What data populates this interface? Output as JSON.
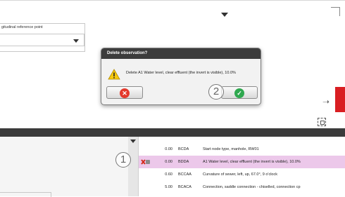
{
  "dialog": {
    "title": "Delete observation?",
    "message": "Delete A1 Water level, clear effluent (the invert is visible), 10.0%",
    "buttons": [
      {
        "name": "cancel",
        "icon": "red-x-icon"
      },
      {
        "name": "ok",
        "icon": "green-check-icon"
      }
    ]
  },
  "callouts": {
    "one": "1",
    "two": "2"
  },
  "left_panel": {
    "group_label": "gitudinal reference point"
  },
  "observations": [
    {
      "distance": "0.00",
      "code": "BCDA",
      "description": "Start node type, manhole, RW01",
      "selected": false
    },
    {
      "distance": "0.00",
      "code": "BDDA",
      "description": "A1 Water level, clear effluent (the invert is visible), 10.0%",
      "selected": true
    },
    {
      "distance": "0.60",
      "code": "BCCAA",
      "description": "Curvature of sewer, left, up, 67.0°, 9 o'clock",
      "selected": false
    },
    {
      "distance": "5.00",
      "code": "BCACA",
      "description": "Connection, saddle connection - chiselled, connection cp",
      "selected": false
    }
  ],
  "colors": {
    "dialog_title_bg": "#3c3c3c",
    "selected_row": "#ecc8ea",
    "cancel": "#e33a2d",
    "ok": "#2fa84f",
    "accent_red": "#d91e22"
  }
}
